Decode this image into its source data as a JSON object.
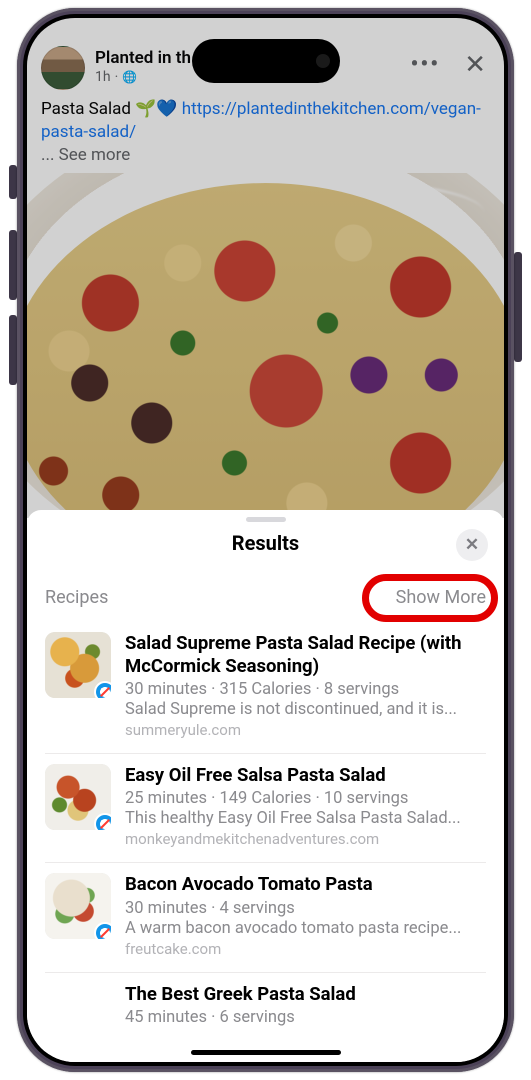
{
  "post": {
    "author": "Planted in th",
    "timestamp": "1h",
    "visibility_icon": "globe-icon",
    "caption_text": "Pasta Salad 🌱💙 ",
    "caption_link": "https://plantedinthekitchen.com/vegan-pasta-salad/",
    "caption_ellipsis": "... ",
    "see_more": "See more"
  },
  "sheet": {
    "title": "Results",
    "section_label": "Recipes",
    "show_more": "Show More",
    "results": [
      {
        "title": "Salad Supreme Pasta Salad Recipe (with McCormick Seasoning)",
        "meta": "30 minutes · 315 Calories · 8 servings",
        "desc": "Salad Supreme is not discontinued, and it is...",
        "source": "summeryule.com"
      },
      {
        "title": "Easy Oil Free Salsa Pasta Salad",
        "meta": "25 minutes · 149 Calories · 10 servings",
        "desc": "This healthy Easy Oil Free Salsa Pasta Salad...",
        "source": "monkeyandmekitchenadventures.com"
      },
      {
        "title": "Bacon Avocado Tomato Pasta",
        "meta": "30 minutes · 4 servings",
        "desc": "A warm bacon avocado tomato pasta recipe...",
        "source": "freutcake.com"
      },
      {
        "title": "The Best Greek Pasta Salad",
        "meta": "45 minutes · 6 servings",
        "desc": "",
        "source": ""
      }
    ]
  }
}
